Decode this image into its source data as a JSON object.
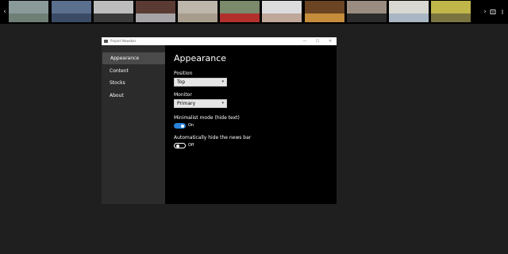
{
  "newsbar": {
    "prev_arrow": "‹",
    "next_arrow": "›",
    "thumbnails": [
      {
        "top": "#8a9a98",
        "bottom": "#6f7f76"
      },
      {
        "top": "#5b6f8f",
        "bottom": "#3b4b66"
      },
      {
        "top": "#bdbdbd",
        "bottom": "#3a3a3a"
      },
      {
        "top": "#5a3b34",
        "bottom": "#a6a4a6"
      },
      {
        "top": "#bdb6aa",
        "bottom": "#a89d8c"
      },
      {
        "top": "#7a8a6a",
        "bottom": "#b1302c"
      },
      {
        "top": "#dcdcdc",
        "bottom": "#bfa79a"
      },
      {
        "top": "#6b4424",
        "bottom": "#c58c3b"
      },
      {
        "top": "#9a8c80",
        "bottom": "#2c2c2c"
      },
      {
        "top": "#d9d7d2",
        "bottom": "#a9b6c3"
      },
      {
        "top": "#c0b64a",
        "bottom": "#7a7440"
      }
    ]
  },
  "window": {
    "title": "Project Newsbar",
    "minimize": "—",
    "maximize": "☐",
    "close": "✕"
  },
  "sidebar": {
    "items": [
      {
        "label": "Appearance"
      },
      {
        "label": "Content"
      },
      {
        "label": "Stocks"
      },
      {
        "label": "About"
      }
    ]
  },
  "settings": {
    "heading": "Appearance",
    "position": {
      "label": "Position",
      "value": "Top"
    },
    "monitor": {
      "label": "Monitor",
      "value": "Primary"
    },
    "minimalist": {
      "label": "Minimalist mode  (hide text)",
      "state": "On"
    },
    "autohide": {
      "label": "Automatically hide the news bar",
      "state": "Off"
    }
  },
  "colors": {
    "accent": "#2a82da",
    "page_background": "#1f1f1f",
    "sidebar_background": "#2b2b2b",
    "selected_item": "#4a4a4a"
  }
}
